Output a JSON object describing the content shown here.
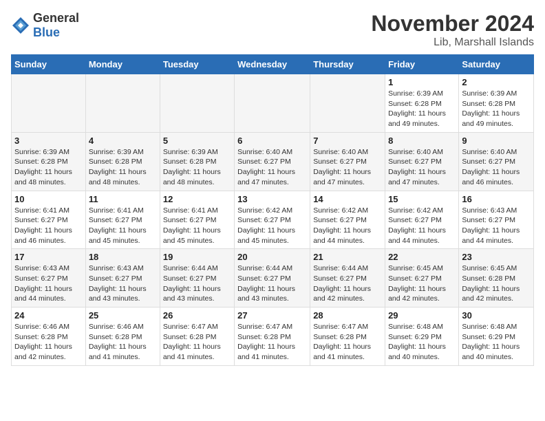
{
  "logo": {
    "text_general": "General",
    "text_blue": "Blue"
  },
  "title": "November 2024",
  "location": "Lib, Marshall Islands",
  "days_of_week": [
    "Sunday",
    "Monday",
    "Tuesday",
    "Wednesday",
    "Thursday",
    "Friday",
    "Saturday"
  ],
  "weeks": [
    [
      {
        "day": "",
        "info": ""
      },
      {
        "day": "",
        "info": ""
      },
      {
        "day": "",
        "info": ""
      },
      {
        "day": "",
        "info": ""
      },
      {
        "day": "",
        "info": ""
      },
      {
        "day": "1",
        "info": "Sunrise: 6:39 AM\nSunset: 6:28 PM\nDaylight: 11 hours and 49 minutes."
      },
      {
        "day": "2",
        "info": "Sunrise: 6:39 AM\nSunset: 6:28 PM\nDaylight: 11 hours and 49 minutes."
      }
    ],
    [
      {
        "day": "3",
        "info": "Sunrise: 6:39 AM\nSunset: 6:28 PM\nDaylight: 11 hours and 48 minutes."
      },
      {
        "day": "4",
        "info": "Sunrise: 6:39 AM\nSunset: 6:28 PM\nDaylight: 11 hours and 48 minutes."
      },
      {
        "day": "5",
        "info": "Sunrise: 6:39 AM\nSunset: 6:28 PM\nDaylight: 11 hours and 48 minutes."
      },
      {
        "day": "6",
        "info": "Sunrise: 6:40 AM\nSunset: 6:27 PM\nDaylight: 11 hours and 47 minutes."
      },
      {
        "day": "7",
        "info": "Sunrise: 6:40 AM\nSunset: 6:27 PM\nDaylight: 11 hours and 47 minutes."
      },
      {
        "day": "8",
        "info": "Sunrise: 6:40 AM\nSunset: 6:27 PM\nDaylight: 11 hours and 47 minutes."
      },
      {
        "day": "9",
        "info": "Sunrise: 6:40 AM\nSunset: 6:27 PM\nDaylight: 11 hours and 46 minutes."
      }
    ],
    [
      {
        "day": "10",
        "info": "Sunrise: 6:41 AM\nSunset: 6:27 PM\nDaylight: 11 hours and 46 minutes."
      },
      {
        "day": "11",
        "info": "Sunrise: 6:41 AM\nSunset: 6:27 PM\nDaylight: 11 hours and 45 minutes."
      },
      {
        "day": "12",
        "info": "Sunrise: 6:41 AM\nSunset: 6:27 PM\nDaylight: 11 hours and 45 minutes."
      },
      {
        "day": "13",
        "info": "Sunrise: 6:42 AM\nSunset: 6:27 PM\nDaylight: 11 hours and 45 minutes."
      },
      {
        "day": "14",
        "info": "Sunrise: 6:42 AM\nSunset: 6:27 PM\nDaylight: 11 hours and 44 minutes."
      },
      {
        "day": "15",
        "info": "Sunrise: 6:42 AM\nSunset: 6:27 PM\nDaylight: 11 hours and 44 minutes."
      },
      {
        "day": "16",
        "info": "Sunrise: 6:43 AM\nSunset: 6:27 PM\nDaylight: 11 hours and 44 minutes."
      }
    ],
    [
      {
        "day": "17",
        "info": "Sunrise: 6:43 AM\nSunset: 6:27 PM\nDaylight: 11 hours and 44 minutes."
      },
      {
        "day": "18",
        "info": "Sunrise: 6:43 AM\nSunset: 6:27 PM\nDaylight: 11 hours and 43 minutes."
      },
      {
        "day": "19",
        "info": "Sunrise: 6:44 AM\nSunset: 6:27 PM\nDaylight: 11 hours and 43 minutes."
      },
      {
        "day": "20",
        "info": "Sunrise: 6:44 AM\nSunset: 6:27 PM\nDaylight: 11 hours and 43 minutes."
      },
      {
        "day": "21",
        "info": "Sunrise: 6:44 AM\nSunset: 6:27 PM\nDaylight: 11 hours and 42 minutes."
      },
      {
        "day": "22",
        "info": "Sunrise: 6:45 AM\nSunset: 6:27 PM\nDaylight: 11 hours and 42 minutes."
      },
      {
        "day": "23",
        "info": "Sunrise: 6:45 AM\nSunset: 6:28 PM\nDaylight: 11 hours and 42 minutes."
      }
    ],
    [
      {
        "day": "24",
        "info": "Sunrise: 6:46 AM\nSunset: 6:28 PM\nDaylight: 11 hours and 42 minutes."
      },
      {
        "day": "25",
        "info": "Sunrise: 6:46 AM\nSunset: 6:28 PM\nDaylight: 11 hours and 41 minutes."
      },
      {
        "day": "26",
        "info": "Sunrise: 6:47 AM\nSunset: 6:28 PM\nDaylight: 11 hours and 41 minutes."
      },
      {
        "day": "27",
        "info": "Sunrise: 6:47 AM\nSunset: 6:28 PM\nDaylight: 11 hours and 41 minutes."
      },
      {
        "day": "28",
        "info": "Sunrise: 6:47 AM\nSunset: 6:28 PM\nDaylight: 11 hours and 41 minutes."
      },
      {
        "day": "29",
        "info": "Sunrise: 6:48 AM\nSunset: 6:29 PM\nDaylight: 11 hours and 40 minutes."
      },
      {
        "day": "30",
        "info": "Sunrise: 6:48 AM\nSunset: 6:29 PM\nDaylight: 11 hours and 40 minutes."
      }
    ]
  ]
}
